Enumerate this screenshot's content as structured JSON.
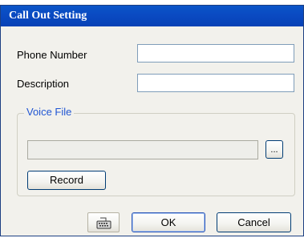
{
  "window": {
    "title": "Call Out Setting"
  },
  "form": {
    "phone_label": "Phone Number",
    "phone_value": "",
    "description_label": "Description",
    "description_value": ""
  },
  "voice_file": {
    "group_label": "Voice File",
    "file_value": "",
    "browse_label": "...",
    "record_label": "Record"
  },
  "footer": {
    "keyboard_icon": "keyboard-icon",
    "ok_label": "OK",
    "cancel_label": "Cancel"
  },
  "colors": {
    "title_bar": "#0a4ac2",
    "dialog_bg": "#f2f1ec",
    "group_title": "#2156d3"
  }
}
